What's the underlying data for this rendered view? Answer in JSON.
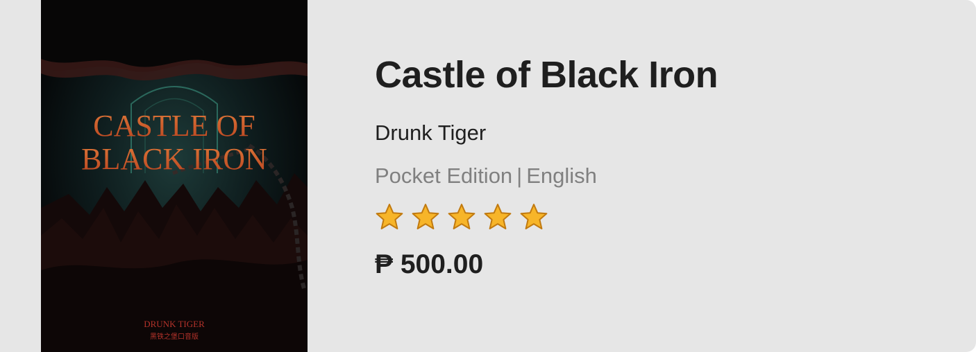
{
  "book": {
    "cover": {
      "title_line1": "CASTLE OF",
      "title_line2": "BLACK IRON",
      "author": "DRUNK TIGER",
      "subtitle": "黑铁之堡口音版"
    },
    "title": "Castle of Black Iron",
    "author": "Drunk Tiger",
    "format": "Pocket Edition",
    "separator": "|",
    "language": "English",
    "rating": {
      "value": 5,
      "max": 5,
      "icon": "star-icon",
      "color": "#f7b529"
    },
    "price": "₱ 500.00"
  },
  "colors": {
    "card_background": "#e6e6e6",
    "title_text": "#1f1f1f",
    "meta_text": "#808080",
    "cover_title": "#d46a2e",
    "cover_author": "#b3322a"
  }
}
